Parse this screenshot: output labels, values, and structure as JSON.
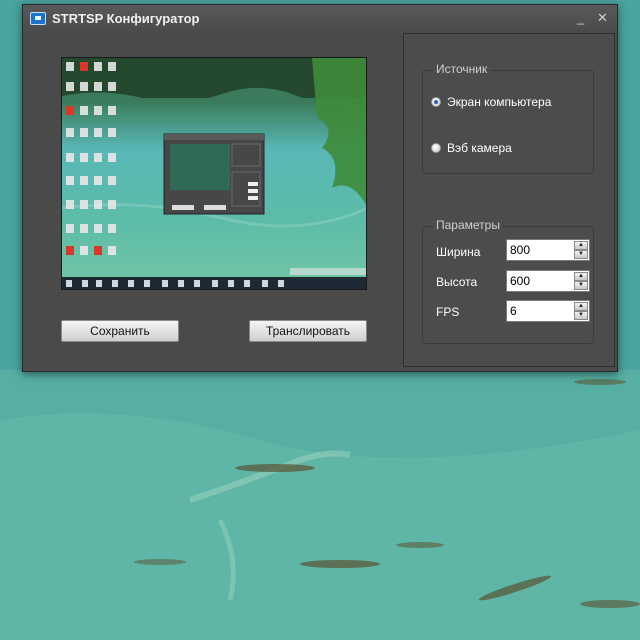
{
  "window": {
    "title": "STRTSP Конфигуратор",
    "minimize_glyph": "_",
    "close_glyph": "✕"
  },
  "preview": {
    "icon_names": [
      "monitor-icon",
      "app-icon"
    ]
  },
  "buttons": {
    "save_label": "Сохранить",
    "stream_label": "Транслировать"
  },
  "source_group": {
    "title": "Источник",
    "options": [
      {
        "label": "Экран компьютера",
        "checked": true
      },
      {
        "label": "Вэб камера",
        "checked": false
      }
    ]
  },
  "params_group": {
    "title": "Параметры",
    "fields": [
      {
        "label": "Ширина",
        "value": "800"
      },
      {
        "label": "Высота",
        "value": "600"
      },
      {
        "label": "FPS",
        "value": "6"
      }
    ]
  },
  "colors": {
    "window_bg": "#4a4a4a",
    "accent": "#2a62b8",
    "water": "#4aa4a0"
  }
}
